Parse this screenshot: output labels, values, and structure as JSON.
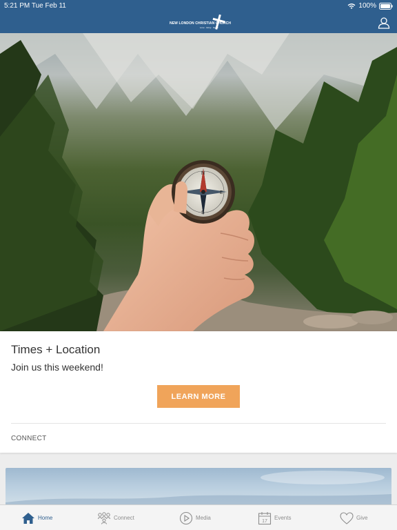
{
  "status_bar": {
    "time_date": "5:21 PM   Tue Feb 11",
    "battery": "100%"
  },
  "header": {
    "logo_text": "NEW LONDON CHRISTIAN CHURCH",
    "logo_subtext": "Love · Glory · Serve"
  },
  "card": {
    "title": "Times + Location",
    "subtitle": "Join us this weekend!",
    "button_label": "LEARN MORE",
    "footer": "CONNECT"
  },
  "tabs": [
    {
      "label": "Home",
      "icon": "home-icon",
      "active": true
    },
    {
      "label": "Connect",
      "icon": "connect-icon",
      "active": false
    },
    {
      "label": "Media",
      "icon": "play-icon",
      "active": false
    },
    {
      "label": "Events",
      "icon": "calendar-icon",
      "active": false
    },
    {
      "label": "Give",
      "icon": "heart-icon",
      "active": false
    }
  ],
  "events_icon_day": "17",
  "colors": {
    "brand": "#2f5f8e",
    "accent": "#f0a45a"
  }
}
